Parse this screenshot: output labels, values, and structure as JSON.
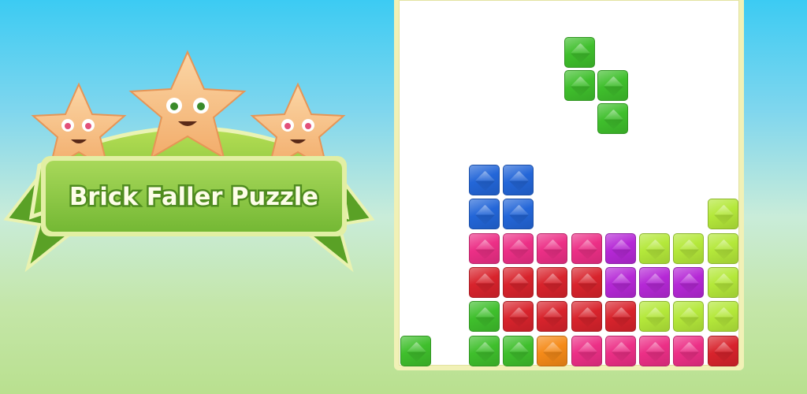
{
  "title": "Brick Faller Puzzle",
  "colors": {
    "green": "#3fbf2c",
    "lime": "#b4e83a",
    "blue": "#2366d8",
    "pink": "#ec2f86",
    "red": "#d8232c",
    "purple": "#b528d6",
    "orange": "#f58a18"
  },
  "falling_piece": {
    "color": "green",
    "cells": [
      [
        0,
        0
      ],
      [
        0,
        1
      ],
      [
        1,
        1
      ],
      [
        1,
        2
      ]
    ]
  },
  "stack": [
    {
      "row": 0,
      "cells": [
        null,
        null,
        "blue",
        "blue",
        null,
        null,
        null,
        null,
        null,
        null
      ]
    },
    {
      "row": 1,
      "cells": [
        null,
        null,
        "blue",
        "blue",
        null,
        null,
        null,
        null,
        null,
        "lime"
      ]
    },
    {
      "row": 2,
      "cells": [
        null,
        null,
        "pink",
        "pink",
        "pink",
        "pink",
        "purple",
        "lime",
        "lime",
        "lime"
      ]
    },
    {
      "row": 3,
      "cells": [
        null,
        null,
        "red",
        "red",
        "red",
        "red",
        "purple",
        "purple",
        "purple",
        "lime"
      ]
    },
    {
      "row": 4,
      "cells": [
        null,
        null,
        "green",
        "red",
        "red",
        "red",
        "red",
        "lime",
        "lime",
        "lime"
      ]
    },
    {
      "row": 5,
      "cells": [
        "green",
        null,
        "green",
        "green",
        "orange",
        "pink",
        "pink",
        "pink",
        "pink",
        "red"
      ]
    }
  ]
}
